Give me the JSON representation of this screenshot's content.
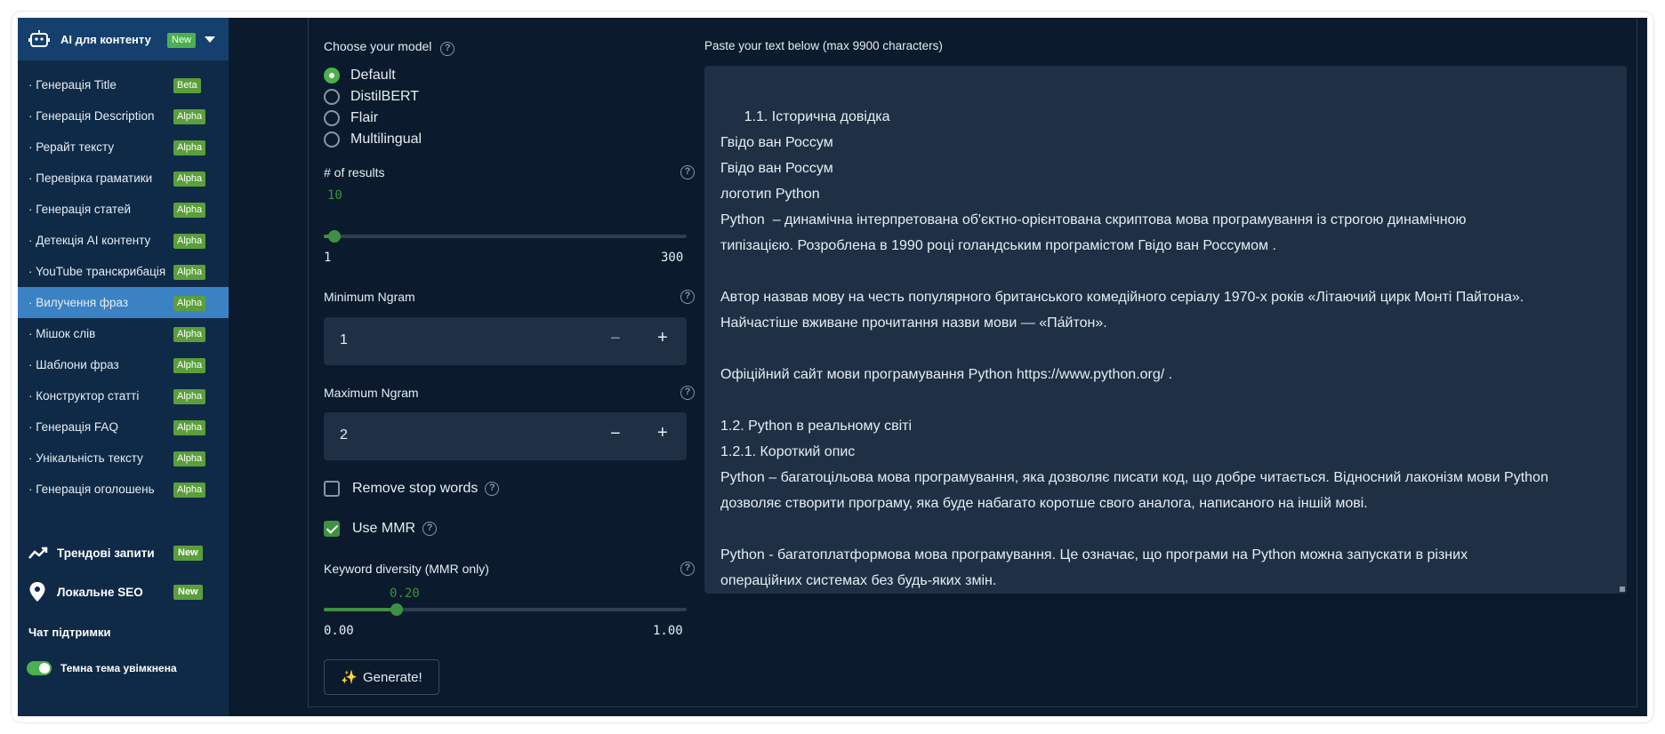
{
  "sidebar": {
    "header": {
      "title": "AI для контенту",
      "badge": "New"
    },
    "items": [
      {
        "label": "· Генерація Title",
        "badge": "Beta",
        "active": false
      },
      {
        "label": "· Генерація Description",
        "badge": "Alpha",
        "active": false
      },
      {
        "label": "· Рерайт тексту",
        "badge": "Alpha",
        "active": false
      },
      {
        "label": "· Перевірка граматики",
        "badge": "Alpha",
        "active": false
      },
      {
        "label": "· Генерація статей",
        "badge": "Alpha",
        "active": false
      },
      {
        "label": "· Детекція AI контенту",
        "badge": "Alpha",
        "active": false
      },
      {
        "label": "· YouTube транскрибація",
        "badge": "Alpha",
        "active": false
      },
      {
        "label": "· Вилучення фраз",
        "badge": "Alpha",
        "active": true
      },
      {
        "label": "· Мішок слів",
        "badge": "Alpha",
        "active": false
      },
      {
        "label": "· Шаблони фраз",
        "badge": "Alpha",
        "active": false
      },
      {
        "label": "· Конструктор статті",
        "badge": "Alpha",
        "active": false
      },
      {
        "label": "· Генерація FAQ",
        "badge": "Alpha",
        "active": false
      },
      {
        "label": "· Унікальність тексту",
        "badge": "Alpha",
        "active": false
      },
      {
        "label": "· Генерація оголошень",
        "badge": "Alpha",
        "active": false
      }
    ],
    "groups": [
      {
        "label": "Трендові запити",
        "badge": "New",
        "icon": "trend-icon"
      },
      {
        "label": "Локальне SEO",
        "badge": "New",
        "icon": "location-pin-icon"
      }
    ],
    "support_label": "Чат підтримки",
    "theme_toggle_label": "Темна тема увімкнена"
  },
  "form": {
    "model_label": "Choose your model",
    "models": [
      "Default",
      "DistilBERT",
      "Flair",
      "Multilingual"
    ],
    "selected_model": "Default",
    "results_label": "# of results",
    "results_value": "10",
    "results_min": "1",
    "results_max": "300",
    "results_fraction": 0.03,
    "min_ngram_label": "Minimum Ngram",
    "min_ngram_value": "1",
    "max_ngram_label": "Maximum Ngram",
    "max_ngram_value": "2",
    "stepper_minus": "−",
    "stepper_plus": "+",
    "remove_stop_words_label": "Remove stop words",
    "remove_stop_words_checked": false,
    "use_mmr_label": "Use MMR",
    "use_mmr_checked": true,
    "diversity_label": "Keyword diversity (MMR only)",
    "diversity_value": "0.20",
    "diversity_min": "0.00",
    "diversity_max": "1.00",
    "diversity_fraction": 0.2,
    "generate_label": "Generate!",
    "help_glyph": "?"
  },
  "text_input": {
    "label": "Paste your text below (max 9900 characters)",
    "value": "1.1. Історична довідка\nГвідо ван Россум\nГвідо ван Россум\nлоготип Python\nPython  – динамічна інтерпретована об'єктно-орієнтована скриптова мова програмування із строгою динамічною\nтипізацією. Розроблена в 1990 році голандським програмістом Гвідо ван Россумом .\n\nАвтор назвав мову на честь популярного британського комедійного серіалу 1970-х років «Літаючий цирк Монті Пайтона».\nНайчастіше вживане прочитання назви мови — «Па́йтон».\n\nОфіційний сайт мови програмування Python https://www.python.org/ .\n\n1.2. Python в реальному світі\n1.2.1. Короткий опис\nPython – багатоцільова мова програмування, яка дозволяє писати код, що добре читається. Відносний лаконізм мови Python\nдозволяє створити програму, яка буде набагато коротше свого аналога, написаного на іншій мові.\n\nPython - багатоплатформова мова програмування. Це означає, що програми на Python можна запускати в різних\nопераційних системах без будь-яких змін."
  },
  "colors": {
    "accent_green": "#3f9142",
    "sidebar_bg": "#0f2a47",
    "active_item": "#3b82c4",
    "app_bg": "#0b1a2c",
    "input_bg": "#1f3044"
  }
}
